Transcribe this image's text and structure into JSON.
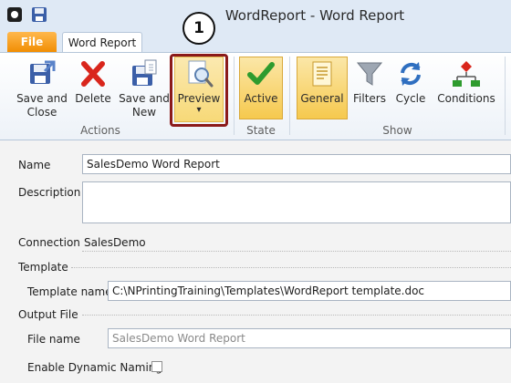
{
  "window": {
    "title": "WordReport - Word Report"
  },
  "tabs": {
    "file": "File",
    "active": "Word Report"
  },
  "ribbon": {
    "actions": {
      "label": "Actions",
      "save_close": [
        "Save and",
        "Close"
      ],
      "delete": "Delete",
      "save_new": [
        "Save and",
        "New"
      ],
      "preview": "Preview",
      "preview_arrow": "▾"
    },
    "state": {
      "label": "State",
      "active": "Active"
    },
    "show": {
      "label": "Show",
      "general": "General",
      "filters": "Filters",
      "cycle": "Cycle",
      "conditions": "Conditions"
    }
  },
  "callout": {
    "number": "1"
  },
  "form": {
    "name": {
      "label": "Name",
      "value": "SalesDemo Word Report"
    },
    "description": {
      "label": "Description",
      "value": ""
    },
    "connection": {
      "label": "Connection",
      "value": "SalesDemo"
    },
    "template": {
      "section": "Template",
      "label": "Template name",
      "value": "C:\\NPrintingTraining\\Templates\\WordReport template.doc"
    },
    "output": {
      "section": "Output File",
      "file_label": "File name",
      "file_value": "SalesDemo Word Report",
      "dynamic_label": "Enable Dynamic Naming",
      "dynamic_checked": false
    }
  },
  "colors": {
    "accent_file_tab": "#f08c00",
    "highlight_box": "#8b1a1a",
    "selected_button": "#f6c94e",
    "delete_red": "#d9261c",
    "active_green": "#2e9b2e"
  }
}
